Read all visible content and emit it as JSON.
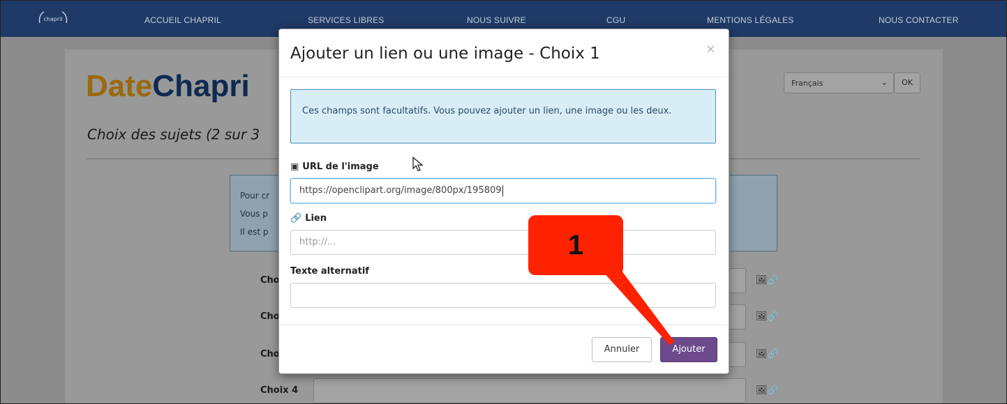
{
  "nav": {
    "logo_text": "chapril",
    "items": [
      "ACCUEIL CHAPRIL",
      "SERVICES LIBRES",
      "NOUS SUIVRE",
      "CGU",
      "MENTIONS LÉGALES",
      "NOUS CONTACTER"
    ]
  },
  "page": {
    "brand_part1": "Date",
    "brand_part2": "Chapri",
    "subtitle": "Choix des sujets (2 sur 3",
    "language": "Français",
    "ok_label": "OK",
    "info_lines": [
      "Pour cr",
      "Vous p",
      "Il est p"
    ],
    "rows": [
      {
        "label": "Cho"
      },
      {
        "label": "Cho"
      },
      {
        "label": "Cho"
      },
      {
        "label": "Choix 4"
      }
    ]
  },
  "modal": {
    "title": "Ajouter un lien ou une image - Choix 1",
    "close": "×",
    "alert_text": "Ces champs sont facultatifs. Vous pouvez ajouter un lien, une image ou les deux.",
    "image_label": "URL de l'image",
    "image_value": "https://openclipart.org/image/800px/195809",
    "link_label": "Lien",
    "link_placeholder": "http://...",
    "alt_label": "Texte alternatif",
    "alt_value": "",
    "cancel_label": "Annuler",
    "add_label": "Ajouter"
  },
  "annotation": {
    "label": "1",
    "color": "#ff2200"
  },
  "colors": {
    "nav_bg": "#1f3a66",
    "primary_button": "#6c4a8c",
    "alert_bg": "#d9edf7"
  }
}
